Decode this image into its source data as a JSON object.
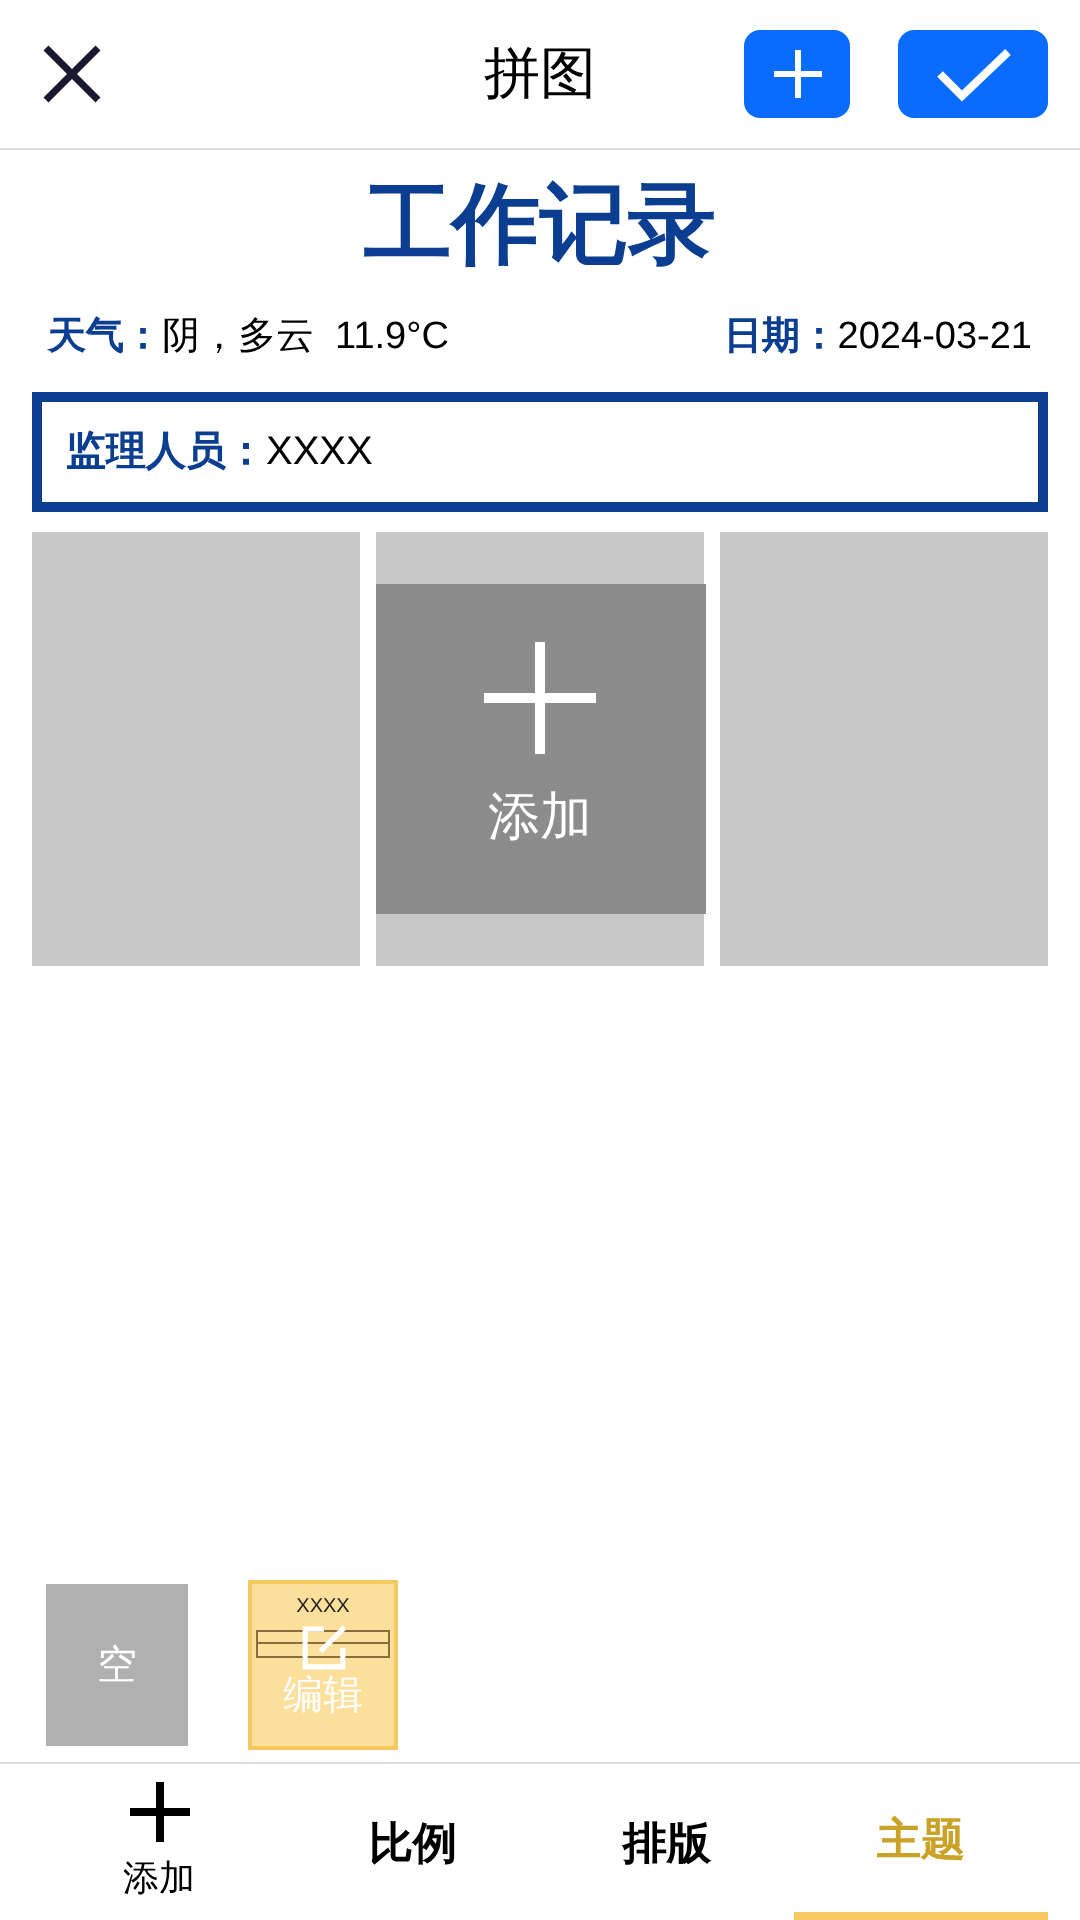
{
  "header": {
    "title": "拼图"
  },
  "record": {
    "title": "工作记录",
    "weather_label": "天气：",
    "weather": "阴，多云  11.9°C",
    "date_label": "日期：",
    "date": "2024-03-21",
    "supervisor_label": "监理人员：",
    "supervisor": "XXXX"
  },
  "photos": [
    {
      "kind": "empty"
    },
    {
      "kind": "add",
      "label": "添加"
    },
    {
      "kind": "empty"
    }
  ],
  "templates": [
    {
      "kind": "blank",
      "label": "空",
      "selected": false
    },
    {
      "kind": "doc",
      "label": "编辑",
      "preview_title": "XXXX",
      "selected": true
    }
  ],
  "bottom_nav": [
    {
      "kind": "icon",
      "label": "添加",
      "selected": false
    },
    {
      "kind": "text",
      "label": "比例",
      "selected": false
    },
    {
      "kind": "text",
      "label": "排版",
      "selected": false
    },
    {
      "kind": "text",
      "label": "主题",
      "selected": true
    }
  ]
}
